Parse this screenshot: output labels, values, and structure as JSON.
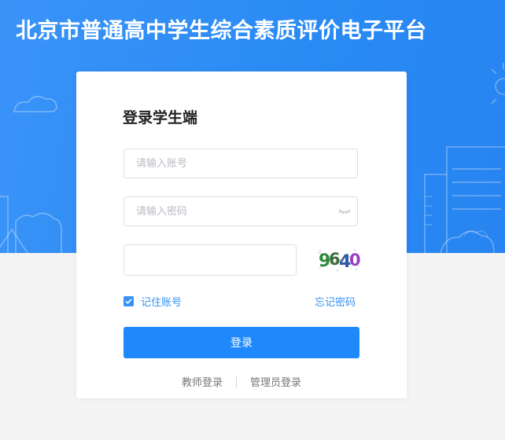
{
  "header": {
    "title": "北京市普通高中学生综合素质评价电子平台"
  },
  "login": {
    "title": "登录学生端",
    "account_placeholder": "请输入账号",
    "password_placeholder": "请输入密码",
    "captcha_value": "",
    "captcha_text": "9640",
    "remember_label": "记住账号",
    "remember_checked": true,
    "forgot_label": "忘记密码",
    "submit_label": "登录"
  },
  "footer_links": {
    "teacher": "教师登录",
    "admin": "管理员登录"
  },
  "colors": {
    "primary": "#1f89fb",
    "link": "#3592f7",
    "hero": "#2a8bf5"
  }
}
